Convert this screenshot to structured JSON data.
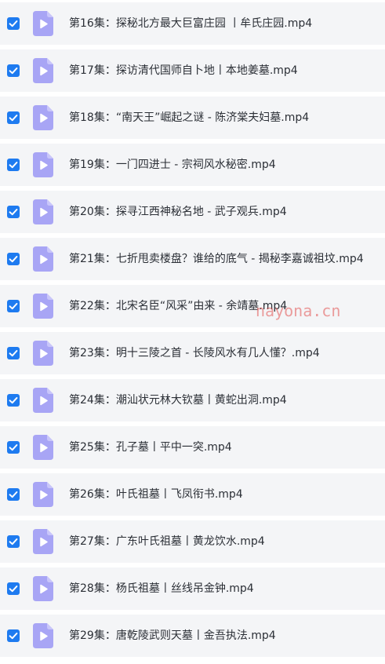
{
  "colors": {
    "checkbox": "#1e7bf0",
    "row_background": "#f4f5f7",
    "video_icon": "#a8a5f5",
    "text": "#2b2f36",
    "watermark": "#e15050"
  },
  "icons": {
    "checkbox": "checkmark-icon",
    "file": "video-file-icon"
  },
  "watermark": "nayona.cn",
  "files": [
    {
      "name": "第16集：探秘北方最大巨富庄园 丨牟氏庄园.mp4",
      "checked": true
    },
    {
      "name": "第17集：探访清代国师自卜地丨本地姜墓.mp4",
      "checked": true
    },
    {
      "name": "第18集：“南天王”崛起之谜 - 陈济棠夫妇墓.mp4",
      "checked": true
    },
    {
      "name": "第19集：一门四进士 - 宗祠风水秘密.mp4",
      "checked": true
    },
    {
      "name": "第20集：探寻江西神秘名地 - 武子观兵.mp4",
      "checked": true
    },
    {
      "name": "第21集：七折甩卖楼盘？谁给的底气 - 揭秘李嘉诚祖坟.mp4",
      "checked": true
    },
    {
      "name": "第22集：北宋名臣“风采”由来 - 余靖墓.mp4",
      "checked": true
    },
    {
      "name": "第23集：明十三陵之首 - 长陵风水有几人懂？.mp4",
      "checked": true
    },
    {
      "name": "第24集：潮汕状元林大钦墓丨黄蛇出洞.mp4",
      "checked": true
    },
    {
      "name": "第25集：孔子墓丨平中一突.mp4",
      "checked": true
    },
    {
      "name": "第26集：叶氏祖墓丨飞凤衔书.mp4",
      "checked": true
    },
    {
      "name": "第27集：广东叶氏祖墓丨黄龙饮水.mp4",
      "checked": true
    },
    {
      "name": "第28集：杨氏祖墓丨丝线吊金钟.mp4",
      "checked": true
    },
    {
      "name": "第29集：唐乾陵武则天墓丨金吾执法.mp4",
      "checked": true
    }
  ]
}
